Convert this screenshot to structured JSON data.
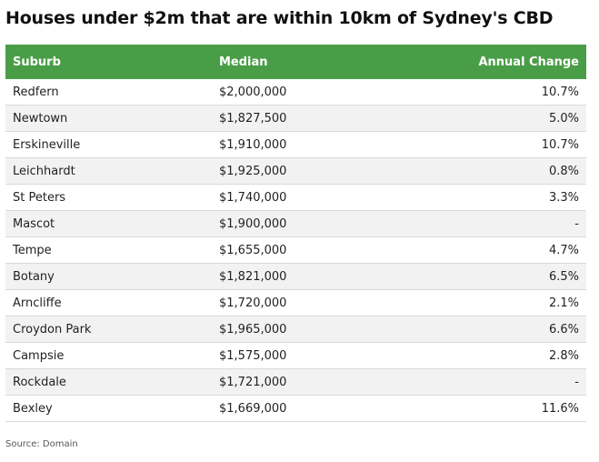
{
  "title": "Houses under $2m that are within 10km of Sydney's CBD",
  "table": {
    "headers": [
      "Suburb",
      "Median",
      "Annual Change"
    ],
    "rows": [
      [
        "Redfern",
        "$2,000,000",
        "10.7%"
      ],
      [
        "Newtown",
        "$1,827,500",
        "5.0%"
      ],
      [
        "Erskineville",
        "$1,910,000",
        "10.7%"
      ],
      [
        "Leichhardt",
        "$1,925,000",
        "0.8%"
      ],
      [
        "St Peters",
        "$1,740,000",
        "3.3%"
      ],
      [
        "Mascot",
        "$1,900,000",
        "-"
      ],
      [
        "Tempe",
        "$1,655,000",
        "4.7%"
      ],
      [
        "Botany",
        "$1,821,000",
        "6.5%"
      ],
      [
        "Arncliffe",
        "$1,720,000",
        "2.1%"
      ],
      [
        "Croydon Park",
        "$1,965,000",
        "6.6%"
      ],
      [
        "Campsie",
        "$1,575,000",
        "2.8%"
      ],
      [
        "Rockdale",
        "$1,721,000",
        "-"
      ],
      [
        "Bexley",
        "$1,669,000",
        "11.6%"
      ]
    ]
  },
  "source": "Source: Domain",
  "colors": {
    "header_bg": "#4a9d47",
    "header_text": "#ffffff",
    "row_alt_bg": "#f2f2f2"
  }
}
